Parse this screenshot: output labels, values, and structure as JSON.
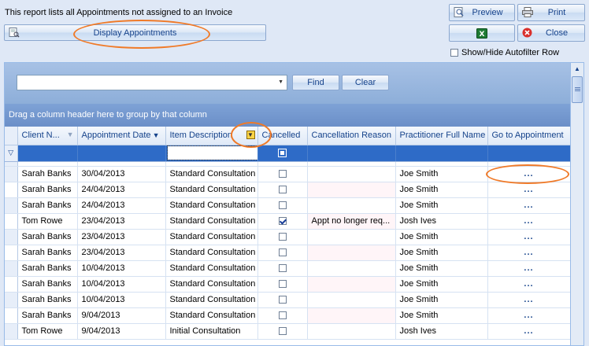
{
  "toolbar": {
    "report_info": "This report lists all Appointments not assigned to an Invoice",
    "display_label": "Display Appointments",
    "preview_label": "Preview",
    "print_label": "Print",
    "close_label": "Close",
    "show_hide_label": "Show/Hide Autofilter Row"
  },
  "find_panel": {
    "search_value": "",
    "find_label": "Find",
    "clear_label": "Clear"
  },
  "group_panel_text": "Drag a column header here to group by that column",
  "columns": {
    "client": "Client N...",
    "date": "Appointment Date",
    "description": "Item Description",
    "cancelled": "Cancelled",
    "reason": "Cancellation Reason",
    "practitioner": "Practitioner Full Name",
    "goto": "Go to Appointment"
  },
  "rows": [
    {
      "client": "Sarah Banks",
      "date": "30/04/2013",
      "description": "Standard Consultation",
      "cancelled": false,
      "reason": "",
      "practitioner": "Joe Smith",
      "goto": "..."
    },
    {
      "client": "Sarah Banks",
      "date": "24/04/2013",
      "description": "Standard Consultation",
      "cancelled": false,
      "reason": "",
      "practitioner": "Joe Smith",
      "goto": "..."
    },
    {
      "client": "Sarah Banks",
      "date": "24/04/2013",
      "description": "Standard Consultation",
      "cancelled": false,
      "reason": "",
      "practitioner": "Joe Smith",
      "goto": "..."
    },
    {
      "client": "Tom Rowe",
      "date": "23/04/2013",
      "description": "Standard Consultation",
      "cancelled": true,
      "reason": "Appt no longer req...",
      "practitioner": "Josh Ives",
      "goto": "..."
    },
    {
      "client": "Sarah Banks",
      "date": "23/04/2013",
      "description": "Standard Consultation",
      "cancelled": false,
      "reason": "",
      "practitioner": "Joe Smith",
      "goto": "..."
    },
    {
      "client": "Sarah Banks",
      "date": "23/04/2013",
      "description": "Standard Consultation",
      "cancelled": false,
      "reason": "",
      "practitioner": "Joe Smith",
      "goto": "..."
    },
    {
      "client": "Sarah Banks",
      "date": "10/04/2013",
      "description": "Standard Consultation",
      "cancelled": false,
      "reason": "",
      "practitioner": "Joe Smith",
      "goto": "..."
    },
    {
      "client": "Sarah Banks",
      "date": "10/04/2013",
      "description": "Standard Consultation",
      "cancelled": false,
      "reason": "",
      "practitioner": "Joe Smith",
      "goto": "..."
    },
    {
      "client": "Sarah Banks",
      "date": "10/04/2013",
      "description": "Standard Consultation",
      "cancelled": false,
      "reason": "",
      "practitioner": "Joe Smith",
      "goto": "..."
    },
    {
      "client": "Sarah Banks",
      "date": "9/04/2013",
      "description": "Standard Consultation",
      "cancelled": false,
      "reason": "",
      "practitioner": "Joe Smith",
      "goto": "..."
    },
    {
      "client": "Tom Rowe",
      "date": "9/04/2013",
      "description": "Initial Consultation",
      "cancelled": false,
      "reason": "",
      "practitioner": "Josh Ives",
      "goto": "..."
    }
  ],
  "colors": {
    "accent": "#15428b",
    "annotation": "#f07a28",
    "filter_row": "#2e6bc7"
  }
}
